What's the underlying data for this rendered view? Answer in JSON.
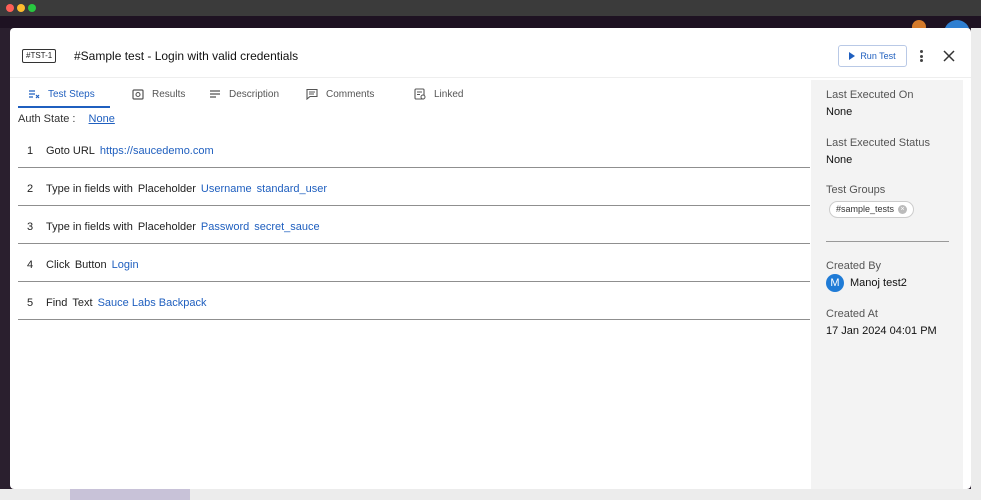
{
  "modal": {
    "test_id": "#TST-1",
    "title": "#Sample test - Login with valid credentials",
    "run_label": "Run Test"
  },
  "tabs": [
    {
      "label": "Test Steps",
      "icon": "steps-icon",
      "active": true
    },
    {
      "label": "Results",
      "icon": "results-icon",
      "active": false
    },
    {
      "label": "Description",
      "icon": "description-icon",
      "active": false
    },
    {
      "label": "Comments",
      "icon": "comments-icon",
      "active": false
    },
    {
      "label": "Linked",
      "icon": "linked-icon",
      "active": false
    }
  ],
  "auth": {
    "label": "Auth State :",
    "value": "None"
  },
  "steps": [
    {
      "num": "1",
      "parts": [
        "Goto URL"
      ],
      "links": [
        "https://saucedemo.com"
      ]
    },
    {
      "num": "2",
      "parts": [
        "Type in fields with",
        "Placeholder"
      ],
      "links": [
        "Username",
        "standard_user"
      ]
    },
    {
      "num": "3",
      "parts": [
        "Type in fields with",
        "Placeholder"
      ],
      "links": [
        "Password",
        "secret_sauce"
      ]
    },
    {
      "num": "4",
      "parts": [
        "Click",
        "Button"
      ],
      "links": [
        "Login"
      ]
    },
    {
      "num": "5",
      "parts": [
        "Find",
        "Text"
      ],
      "links": [
        "Sauce Labs Backpack"
      ]
    }
  ],
  "sidebar": {
    "last_executed_on_label": "Last Executed On",
    "last_executed_on_value": "None",
    "last_status_label": "Last Executed Status",
    "last_status_value": "None",
    "groups_label": "Test Groups",
    "group_chip": "#sample_tests",
    "created_by_label": "Created By",
    "created_by_initial": "M",
    "created_by_value": "Manoj test2",
    "created_at_label": "Created At",
    "created_at_value": "17 Jan 2024 04:01 PM"
  },
  "colors": {
    "accent": "#1f5fbf",
    "sidebar_bg": "#f3f3f3"
  }
}
